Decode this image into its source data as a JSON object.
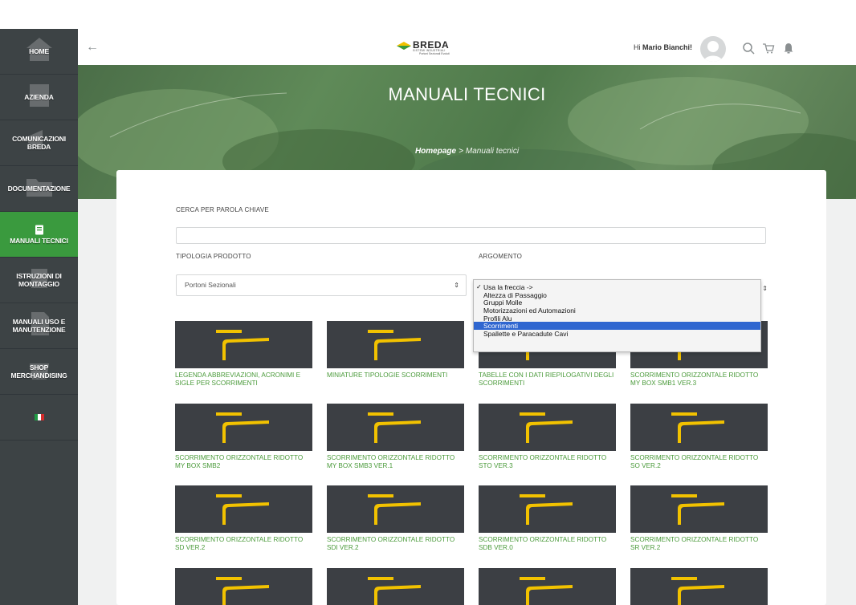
{
  "sidebar": {
    "items": [
      {
        "label": "HOME",
        "icon": "home-icon"
      },
      {
        "label": "AZIENDA",
        "icon": "building-icon"
      },
      {
        "label": "COMUNICAZIONI\nBREDA",
        "icon": "megaphone-icon"
      },
      {
        "label": "DOCUMENTAZIONE",
        "icon": "folder-icon"
      },
      {
        "label": "MANUALI TECNICI",
        "icon": "book-icon"
      },
      {
        "label": "ISTRUZIONI DI\nMONTAGGIO",
        "icon": "tools-icon"
      },
      {
        "label": "MANUALI USO E\nMANUTENZIONE",
        "icon": "document-icon"
      },
      {
        "label": "SHOP\nMERCHANDISING",
        "icon": "shop-icon"
      }
    ],
    "flag": {
      "icon": "italy-flag-icon",
      "colors": [
        "#1f9a43",
        "#ffffff",
        "#d22b2b"
      ]
    }
  },
  "header": {
    "logo_brand": "BREDA",
    "logo_tagline": "SISTEMI INDUSTRIALI",
    "logo_tagline2": "Portoni Sezionali Evoluti",
    "greeting_prefix": "Hi",
    "user_name": "Mario Bianchi!"
  },
  "hero": {
    "title": "MANUALI TECNICI",
    "breadcrumb_home": "Homepage",
    "breadcrumb_sep": ">",
    "breadcrumb_current": "Manuali tecnici"
  },
  "filters": {
    "search_label": "CERCA PER PAROLA CHIAVE",
    "search_value": "",
    "product_label": "TIPOLOGIA PRODOTTO",
    "product_selected": "Portoni Sezionali",
    "topic_label": "ARGOMENTO",
    "topic_options": [
      "Usa la freccia ->",
      "Altezza di Passaggio",
      "Gruppi Molle",
      "Motorizzazioni ed Automazioni",
      "Profili Alu",
      "Scorrimenti",
      "Spallette e Paracadute Cavi"
    ],
    "topic_checked_index": 0,
    "topic_highlight_index": 5
  },
  "products": [
    "LEGENDA ABBREVIAZIONI, ACRONIMI E SIGLE PER SCORRIMENTI",
    "MINIATURE TIPOLOGIE SCORRIMENTI",
    "TABELLE CON I DATI RIEPILOGATIVI DEGLI SCORRIMENTI",
    "SCORRIMENTO ORIZZONTALE RIDOTTO MY BOX SMB1 VER.3",
    "SCORRIMENTO ORIZZONTALE RIDOTTO MY BOX SMB2",
    "SCORRIMENTO ORIZZONTALE RIDOTTO MY BOX SMB3 VER.1",
    "SCORRIMENTO ORIZZONTALE RIDOTTO STO VER.3",
    "SCORRIMENTO ORIZZONTALE RIDOTTO SO VER.2",
    "SCORRIMENTO ORIZZONTALE RIDOTTO SD VER.2",
    "SCORRIMENTO ORIZZONTALE RIDOTTO SDI VER.2",
    "SCORRIMENTO ORIZZONTALE RIDOTTO SDB VER.0",
    "SCORRIMENTO ORIZZONTALE RIDOTTO SR VER.2",
    "",
    "",
    "",
    ""
  ],
  "colors": {
    "sidebar_bg": "#3d4345",
    "sidebar_active": "#3a9a3e",
    "accent_green": "#4a9a3a",
    "thumb_bg": "#3c3f44",
    "thumb_yellow": "#f2c200",
    "dropdown_highlight": "#2f66d0"
  }
}
